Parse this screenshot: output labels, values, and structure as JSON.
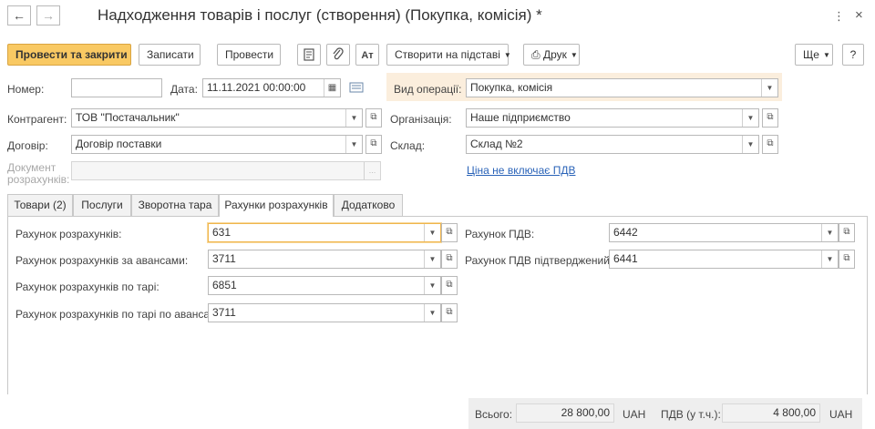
{
  "window": {
    "title": "Надходження товарів і послуг (створення) (Покупка, комісія) *",
    "more_icon": "⋮",
    "close_icon": "×"
  },
  "toolbar": {
    "post_close": "Провести та закрити",
    "save": "Записати",
    "post": "Провести",
    "create_based": "Створити на підставі",
    "print": "Друк",
    "more": "Ще",
    "help": "?",
    "dt_kt_glyph": "Ат"
  },
  "header": {
    "number_label": "Номер:",
    "number_value": "",
    "date_label": "Дата:",
    "date_value": "11.11.2021 00:00:00",
    "operation_label": "Вид операції:",
    "operation_value": "Покупка, комісія",
    "counterparty_label": "Контрагент:",
    "counterparty_value": "ТОВ \"Постачальник\"",
    "organization_label": "Організація:",
    "organization_value": "Наше підприємство",
    "contract_label": "Договір:",
    "contract_value": "Договір поставки",
    "warehouse_label": "Склад:",
    "warehouse_value": "Склад №2",
    "settlement_doc_label_1": "Документ",
    "settlement_doc_label_2": "розрахунків:",
    "settlement_doc_value": "",
    "price_link": "Ціна не включає ПДВ"
  },
  "tabs": [
    {
      "label": "Товари (2)"
    },
    {
      "label": "Послуги"
    },
    {
      "label": "Зворотна тара"
    },
    {
      "label": "Рахунки розрахунків"
    },
    {
      "label": "Додатково"
    }
  ],
  "accounts": {
    "settlement_label": "Рахунок розрахунків:",
    "settlement_value": "631",
    "advance_label": "Рахунок розрахунків за авансами:",
    "advance_value": "3711",
    "tare_label": "Рахунок розрахунків по тарі:",
    "tare_value": "6851",
    "tare_advance_label": "Рахунок розрахунків по тарі по авансах:",
    "tare_advance_value": "3711",
    "vat_label": "Рахунок ПДВ:",
    "vat_value": "6442",
    "vat_confirmed_label": "Рахунок ПДВ підтверджений:",
    "vat_confirmed_value": "6441"
  },
  "footer": {
    "total_label": "Всього:",
    "total_value": "28 800,00",
    "total_currency": "UAH",
    "vat_label": "ПДВ (у т.ч.):",
    "vat_value": "4 800,00",
    "vat_currency": "UAH"
  },
  "colors": {
    "primary_button": "#f9c963",
    "highlight": "#fbeedd",
    "link": "#2a63b8",
    "focus": "#f0b64c"
  }
}
